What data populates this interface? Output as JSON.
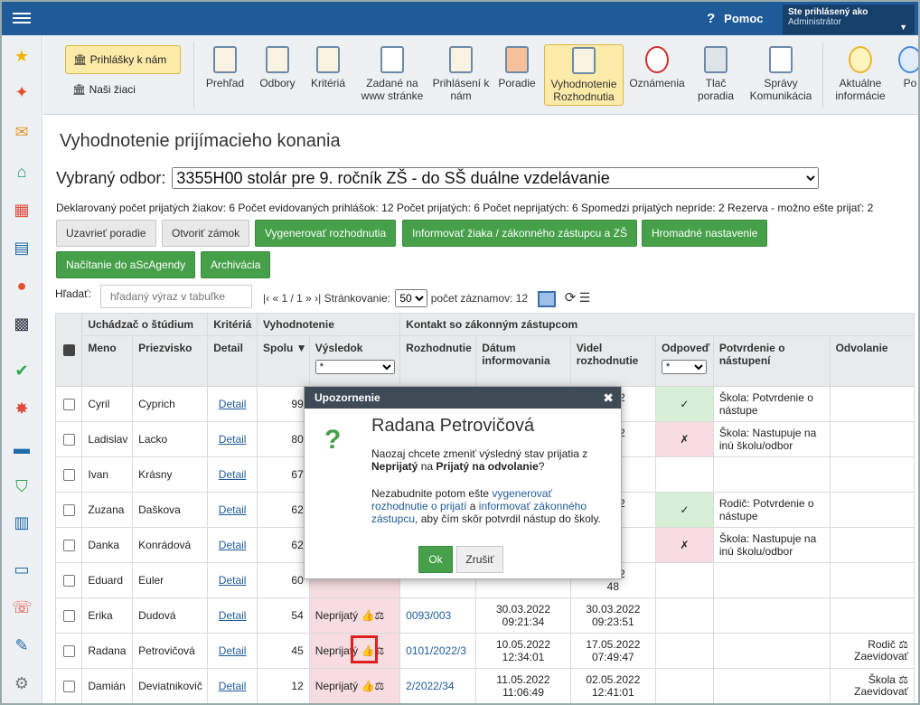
{
  "topbar": {
    "help": "Pomoc",
    "user_line1": "Ste prihlásený ako",
    "user_line2": "Administrátor"
  },
  "toolbar": {
    "prihlasky": "Prihlášky k nám",
    "nasi": "Naši žiaci",
    "items": [
      "Prehľad",
      "Odbory",
      "Kritériá",
      "Zadané na www stránke",
      "Prihlásení k nám",
      "Poradie",
      "Vyhodnotenie Rozhodnutia",
      "Oznámenia",
      "Tlač poradia",
      "Správy Komunikácia",
      "Aktuálne informácie",
      "Po"
    ]
  },
  "page": {
    "title": "Vyhodnotenie prijímacieho konania",
    "odbor_label": "Vybraný odbor:",
    "odbor_value": "3355H00 stolár pre 9. ročník ZŠ - do SŠ duálne vzdelávanie",
    "stats": "Deklarovaný počet prijatých žiakov: 6 Počet evidovaných prihlášok: 12 Počet prijatých: 6 Počet neprijatých: 6 Spomedzi prijatých nepríde: 2 Rezerva - možno ešte prijať: 2"
  },
  "buttons": {
    "uzavriet": "Uzavrieť poradie",
    "otvorit": "Otvoriť zámok",
    "vygenerovat": "Vygenerovať rozhodnutia",
    "informovat": "Informovať žiaka / zákonného zástupcu a ZŠ",
    "hromadne": "Hromadné nastavenie",
    "nacitanie": "Načítanie do aScAgendy",
    "archivacia": "Archivácia"
  },
  "search": {
    "label": "Hľadať:",
    "placeholder": "hľadaný výraz v tabuľke",
    "pager": "|‹ « 1 / 1 » ›|",
    "strankovanie": "Stránkovanie:",
    "page_size": "50",
    "zaznamy": "počet záznamov: 12"
  },
  "headers": {
    "uchadzac": "Uchádzač o štúdium",
    "kriteria": "Kritériá",
    "vyhodnotenie": "Vyhodnotenie",
    "kontakt": "Kontakt so zákonným zástupcom",
    "meno": "Meno",
    "priezvisko": "Priezvisko",
    "detail": "Detail",
    "spolu": "Spolu",
    "vysledok": "Výsledok",
    "rozhodnutie": "Rozhodnutie",
    "datum": "Dátum informovania",
    "videl": "Videl rozhodnutie",
    "odpoved": "Odpoveď",
    "potvrdenie": "Potvrdenie o nástupení",
    "odvolanie": "Odvolanie",
    "filter_all": "*"
  },
  "rows": [
    {
      "meno": "Cyril",
      "priezvisko": "Cyprich",
      "detail": "Detail",
      "spolu": "99",
      "vysledok": "",
      "rozh": "",
      "datum": "",
      "videl": "2022\n05",
      "odp": "✓",
      "potv": "Škola: Potvrdenie o nástupe",
      "odv": ""
    },
    {
      "meno": "Ladislav",
      "priezvisko": "Lacko",
      "detail": "Detail",
      "spolu": "80",
      "vysledok": "",
      "rozh": "",
      "datum": "",
      "videl": "2022\n03",
      "odp": "✗",
      "potv": "Škola: Nastupuje na inú školu/odbor",
      "odv": ""
    },
    {
      "meno": "Ivan",
      "priezvisko": "Krásny",
      "detail": "Detail",
      "spolu": "67",
      "vysledok": "",
      "rozh": "",
      "datum": "",
      "videl": "nie",
      "odp": "",
      "potv": "",
      "odv": ""
    },
    {
      "meno": "Zuzana",
      "priezvisko": "Daškova",
      "detail": "Detail",
      "spolu": "62",
      "vysledok": "",
      "rozh": "",
      "datum": "",
      "videl": "2022\n00",
      "odp": "✓",
      "potv": "Rodič: Potvrdenie o nástupe",
      "odv": ""
    },
    {
      "meno": "Danka",
      "priezvisko": "Konrádová",
      "detail": "Detail",
      "spolu": "62",
      "vysledok": "",
      "rozh": "",
      "datum": "",
      "videl": "nie",
      "odp": "✗",
      "potv": "Škola: Nastupuje na inú školu/odbor",
      "odv": ""
    },
    {
      "meno": "Eduard",
      "priezvisko": "Euler",
      "detail": "Detail",
      "spolu": "60",
      "vysledok": "",
      "rozh": "",
      "datum": "",
      "videl": "2022\n48",
      "odp": "",
      "potv": "",
      "odv": ""
    },
    {
      "meno": "Erika",
      "priezvisko": "Dudová",
      "detail": "Detail",
      "spolu": "54",
      "vysledok": "Neprijatý",
      "rozh": "0093/003",
      "datum": "30.03.2022\n09:21:34",
      "videl": "30.03.2022\n09:23:51",
      "odp": "",
      "potv": "",
      "odv": ""
    },
    {
      "meno": "Radana",
      "priezvisko": "Petrovičová",
      "detail": "Detail",
      "spolu": "45",
      "vysledok": "Neprijatý",
      "rozh": "0101/2022/3",
      "datum": "10.05.2022\n12:34:01",
      "videl": "17.05.2022\n07:49:47",
      "odp": "",
      "potv": "",
      "odv": "Rodič ⚖\nZaevidovať"
    },
    {
      "meno": "Damián",
      "priezvisko": "Deviatnikovič",
      "detail": "Detail",
      "spolu": "12",
      "vysledok": "Neprijatý",
      "rozh": "2/2022/34",
      "datum": "11.05.2022\n11:06:49",
      "videl": "02.05.2022\n12:41:01",
      "odp": "",
      "potv": "",
      "odv": "Škola ⚖\nZaevidovať"
    }
  ],
  "dialog": {
    "title": "Upozornenie",
    "name": "Radana Petrovičová",
    "line1a": "Naozaj chcete zmeniť výsledný stav prijatia z",
    "line1b": "Neprijatý",
    "line1c": "na",
    "line1d": "Prijatý na odvolanie",
    "line1e": "?",
    "line2a": "Nezabudnite potom ešte",
    "link1": "vygenerovať rozhodnutie o prijatí",
    "line2b": "a",
    "link2": "informovať zákonného zástupcu",
    "line2c": ", aby čím skôr potvrdil nástup do školy.",
    "ok": "Ok",
    "cancel": "Zrušiť"
  }
}
